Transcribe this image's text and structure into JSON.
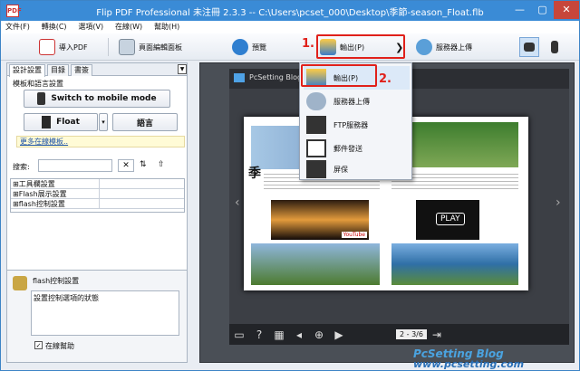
{
  "window": {
    "title": "Flip PDF Professional 未注冊 2.3.3 -- C:\\Users\\pcset_000\\Desktop\\季節-season_Float.flb",
    "app_icon_text": "PDF",
    "min": "—",
    "max": "▢",
    "close": "✕"
  },
  "menubar": [
    "文件(F)",
    "轉換(C)",
    "選項(V)",
    "在線(W)",
    "幫助(H)"
  ],
  "toolbar": {
    "import_pdf": "導入PDF",
    "page_editor": "頁面編輯面板",
    "preview": "預覽",
    "output": "輸出(P)",
    "output_arrow": "❯",
    "upload": "服務器上傳"
  },
  "left_panel": {
    "tabs": [
      "設計設置",
      "目錄",
      "書簽"
    ],
    "lang_section": "模板和語言設置",
    "switch_mobile": "Switch to mobile mode",
    "template": "Float",
    "language": "語言",
    "more_templates": "更多在線模板..",
    "search_label": "搜索:",
    "search_value": "",
    "tree": [
      {
        "c1": "⊞工具欄設置",
        "c2": ""
      },
      {
        "c1": "⊞Flash展示設置",
        "c2": ""
      },
      {
        "c1": "⊞flash控制設置",
        "c2": ""
      }
    ],
    "flash_section": "flash控制設置",
    "flash_desc": "設置控制選項的狀態",
    "online_help": "在線幫助"
  },
  "viewer": {
    "header": "PcSetting Blog",
    "page_indicator": "2 - 3/6"
  },
  "dropdown": {
    "items": [
      "輸出(P)",
      "服務器上傳",
      "FTP服務器",
      "郵件發送",
      "屏保"
    ]
  },
  "annotations": {
    "step1": "1.",
    "step2": "2."
  },
  "watermark": {
    "line1": "PcSetting Blog",
    "line2": "www.pcsetting.com"
  },
  "book": {
    "play_label": "PLAY",
    "youtube_label": "YouTube",
    "big_char": "季"
  },
  "colors": {
    "accent": "#3a8bd6",
    "annotation_red": "#e0201a"
  }
}
